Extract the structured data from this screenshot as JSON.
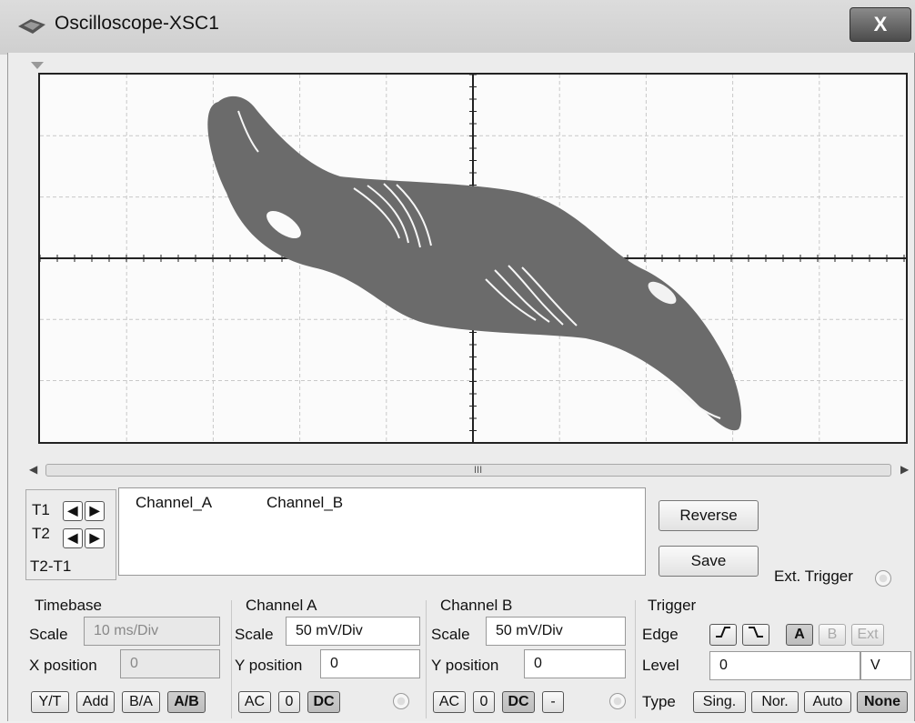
{
  "window": {
    "title": "Oscilloscope-XSC1",
    "close_label": "X"
  },
  "scrollbar": {
    "grip": "III",
    "left_arrow": "◀",
    "right_arrow": "▶"
  },
  "cursors": {
    "t1_label": "T1",
    "t2_label": "T2",
    "t2t1_label": "T2-T1",
    "left_arrow": "◀",
    "right_arrow": "▶"
  },
  "readout": {
    "col_a": "Channel_A",
    "col_b": "Channel_B"
  },
  "buttons": {
    "reverse": "Reverse",
    "save": "Save"
  },
  "ext_trigger": {
    "label": "Ext. Trigger"
  },
  "timebase": {
    "title": "Timebase",
    "scale_label": "Scale",
    "scale_value": "10 ms/Div",
    "xpos_label": "X position",
    "xpos_value": "0",
    "modes": [
      "Y/T",
      "Add",
      "B/A",
      "A/B"
    ],
    "active_mode": "A/B"
  },
  "channel_a": {
    "title": "Channel A",
    "scale_label": "Scale",
    "scale_value": "50 mV/Div",
    "ypos_label": "Y position",
    "ypos_value": "0",
    "coupling": [
      "AC",
      "0",
      "DC"
    ]
  },
  "channel_b": {
    "title": "Channel B",
    "scale_label": "Scale",
    "scale_value": "50 mV/Div",
    "ypos_label": "Y position",
    "ypos_value": "0",
    "coupling": [
      "AC",
      "0",
      "DC",
      "-"
    ]
  },
  "trigger": {
    "title": "Trigger",
    "edge_label": "Edge",
    "edge_buttons": [
      "A",
      "B",
      "Ext"
    ],
    "level_label": "Level",
    "level_value": "0",
    "level_unit": "V",
    "type_label": "Type",
    "types": [
      "Sing.",
      "Nor.",
      "Auto",
      "None"
    ],
    "active_type": "None"
  },
  "colors": {
    "trace": "#6b6b6b",
    "grid": "#c8c8c8",
    "screen_bg": "#fbfbfb"
  }
}
